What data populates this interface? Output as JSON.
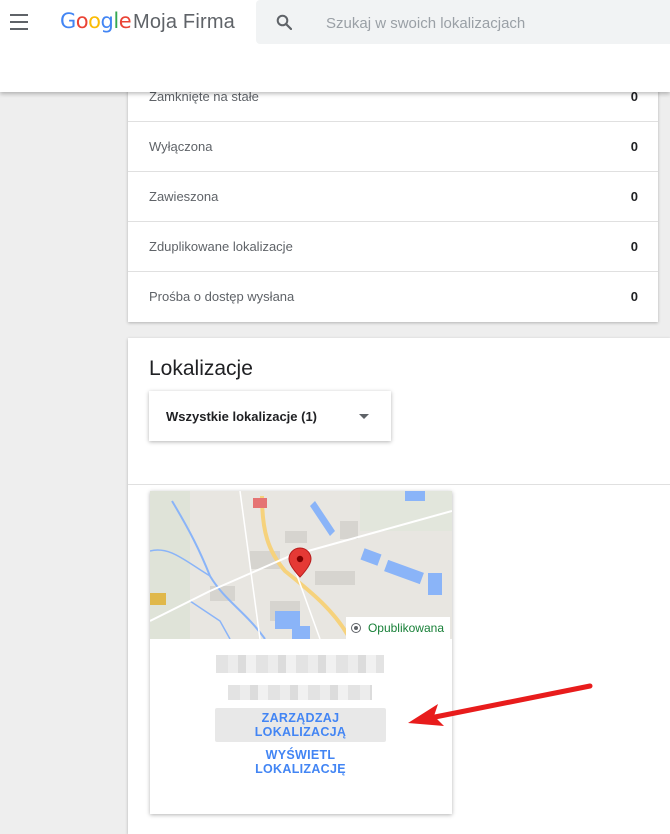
{
  "header": {
    "logo_text": "Google",
    "product_name": "Moja Firma",
    "search_placeholder": "Szukaj w swoich lokalizacjach",
    "menu_icon": "hamburger-menu-icon",
    "search_icon": "search-icon"
  },
  "status_list": [
    {
      "label": "Zamknięte na stałe",
      "count": "0"
    },
    {
      "label": "Wyłączona",
      "count": "0"
    },
    {
      "label": "Zawieszona",
      "count": "0"
    },
    {
      "label": "Zduplikowane lokalizacje",
      "count": "0"
    },
    {
      "label": "Prośba o dostęp wysłana",
      "count": "0"
    }
  ],
  "locations": {
    "title": "Lokalizacje",
    "filter_label": "Wszystkie lokalizacje (1)",
    "card": {
      "status": "Opublikowana",
      "status_color": "#188038",
      "manage_label": "ZARZĄDZAJ LOKALIZACJĄ",
      "view_label": "WYŚWIETL LOKALIZACJĘ"
    }
  },
  "colors": {
    "accent": "#4285f4",
    "annotation_arrow": "#e81c1c"
  }
}
